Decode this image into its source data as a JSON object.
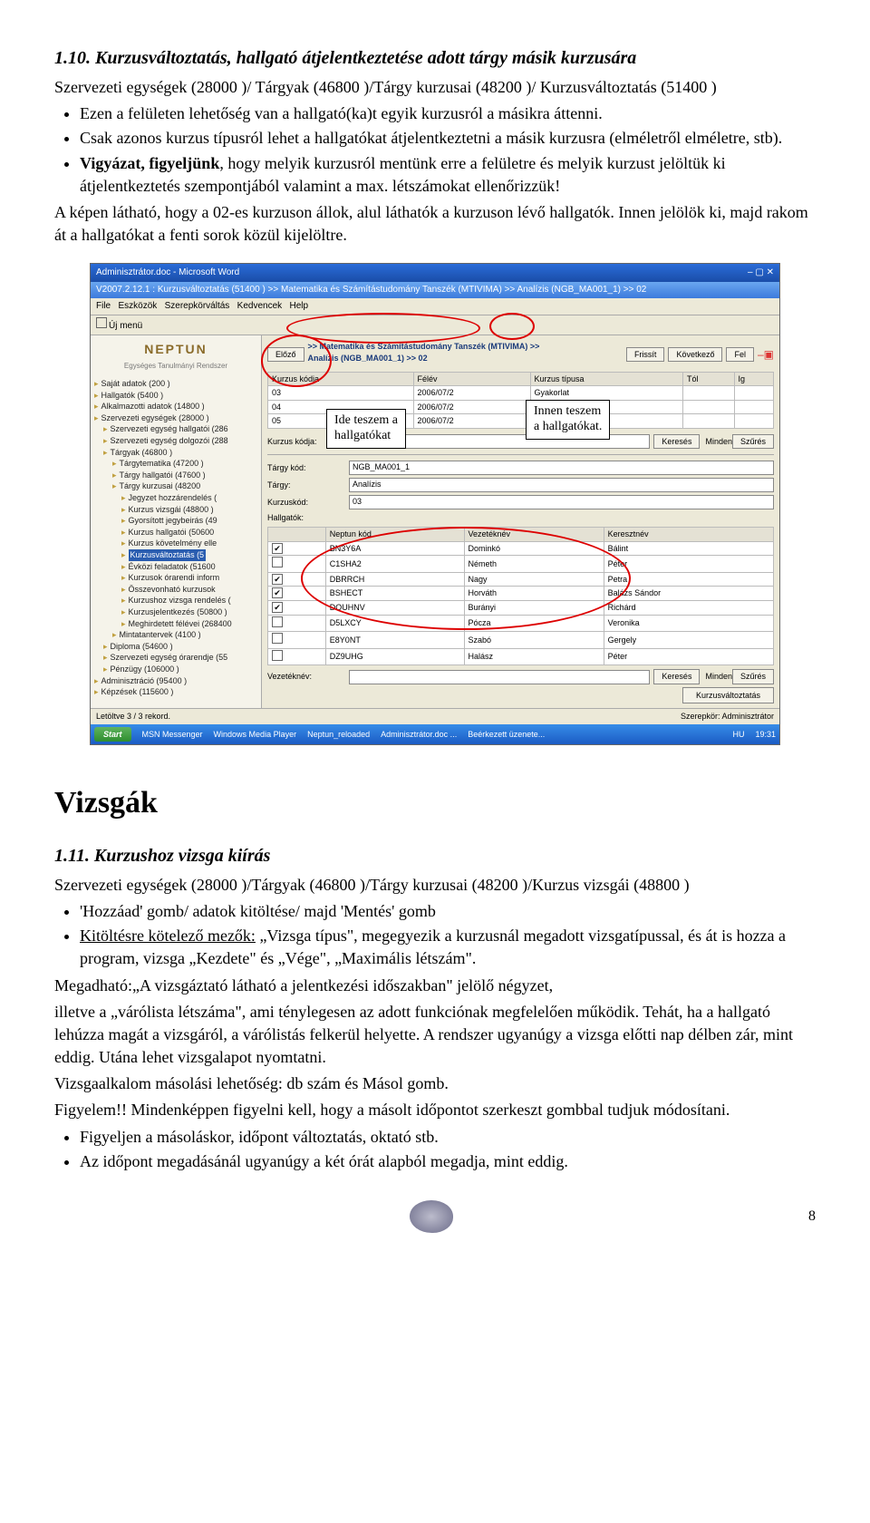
{
  "section1": {
    "heading": "1.10. Kurzusváltoztatás, hallgató átjelentkeztetése adott tárgy másik kurzusára",
    "path": "Szervezeti egységek (28000  )/ Tárgyak (46800  )/Tárgy kurzusai (48200  )/ Kurzusváltoztatás (51400  )",
    "b1": "Ezen a felületen lehetőség van a hallgató(ka)t egyik kurzusról a másikra áttenni.",
    "b2": "Csak azonos kurzus típusról lehet a hallgatókat átjelentkeztetni a másik kurzusra (elméletről elméletre, stb).",
    "b3a": "Vigyázat, figyeljünk",
    "b3b": ", hogy melyik kurzusról mentünk erre a felületre és melyik kurzust jelöltük ki átjelentkeztetés szempontjából valamint a max. létszámokat ellenőrizzük!",
    "p1": "A képen látható, hogy a 02-es kurzuson állok, alul láthatók a kurzuson lévő hallgatók. Innen jelölök ki, majd rakom át a hallgatókat a fenti sorok közül kijelöltre."
  },
  "screenshot": {
    "wordTitle": "Adminisztrátor.doc - Microsoft Word",
    "appTitle": "V2007.2.12.1 : Kurzusváltoztatás (51400  )  >> Matematika és Számítástudomány Tanszék (MTIVIMA) >> Analízis (NGB_MA001_1) >> 02",
    "menus": [
      "File",
      "Eszközök",
      "Szerepkörváltás",
      "Kedvencek",
      "Help"
    ],
    "ujmenu": "Új menü",
    "logo": "NEPTUN",
    "logoSub": "Egységes Tanulmányi Rendszer",
    "tree": [
      "Saját adatok (200  )",
      "Hallgatók (5400  )",
      "Alkalmazotti adatok (14800  )",
      "Szervezeti egységek (28000  )",
      "  Szervezeti egység hallgatói (286",
      "  Szervezeti egység dolgozói (288",
      "  Tárgyak (46800  )",
      "    Tárgytematika (47200  )",
      "    Tárgy hallgatói (47600  )",
      "    Tárgy kurzusai (48200",
      "      Jegyzet hozzárendelés (",
      "      Kurzus vizsgái (48800  )",
      "      Gyorsított jegybeirás (49",
      "      Kurzus hallgatói (50600",
      "      Kurzus követelmény elle",
      "      Kurzusváltoztatás (5",
      "      Évközi feladatok (51600",
      "      Kurzusok órarendi inform",
      "      Összevonható kurzusok",
      "      Kurzushoz vizsga rendelés (",
      "      Kurzusjelentkezés (50800  )",
      "      Meghirdetett félévei (268400",
      "    Mintatantervek (4100  )",
      "  Diploma (54600  )",
      "  Szervezeti egység órarendje (55",
      "  Pénzügy (106000  )",
      "Adminisztráció (95400  )",
      "Képzések (115600  )"
    ],
    "treeSelected": 15,
    "navBtns": [
      "Előző",
      "Frissít",
      "Következő",
      "Fel"
    ],
    "bc1": ">> Matematika és Számítástudomány Tanszék (MTIVIMA) >>",
    "bc2": "Analízis (NGB_MA001_1) >> 02",
    "topHeaders": [
      "Kurzus kódja",
      "Félév",
      "Kurzus típusa",
      "Tól",
      "Ig"
    ],
    "topRows": [
      [
        "03",
        "2006/07/2",
        "Gyakorlat",
        "",
        ""
      ],
      [
        "04",
        "2006/07/2",
        "Gyakorlat",
        "",
        ""
      ],
      [
        "05",
        "2006/07/2",
        "Gyakorlat",
        "",
        ""
      ]
    ],
    "filterLabel": "Kurzus kódja:",
    "keres": "Keresés",
    "minden": "Minden",
    "szures": "Szűrés",
    "formLabels": {
      "targyKod": "Tárgy kód:",
      "targyKodVal": "NGB_MA001_1",
      "targy": "Tárgy:",
      "targyVal": "Analízis",
      "kurzusKod": "Kurzuskód:",
      "kurzusKodVal": "03",
      "hallgatok": "Hallgatók:"
    },
    "stHeaders": [
      "",
      "Neptun kód",
      "Vezetéknév",
      "Keresztnév"
    ],
    "stRows": [
      [
        "✔",
        "BN3Y6A",
        "Dominkó",
        "Bálint"
      ],
      [
        "",
        "C1SHA2",
        "Németh",
        "Péter"
      ],
      [
        "✔",
        "DBRRCH",
        "Nagy",
        "Petra"
      ],
      [
        "✔",
        "BSHECT",
        "Horváth",
        "Balázs Sándor"
      ],
      [
        "✔",
        "DOUHNV",
        "Burányi",
        "Richárd"
      ],
      [
        "",
        "D5LXCY",
        "Pócza",
        "Veronika"
      ],
      [
        "",
        "E8Y0NT",
        "Szabó",
        "Gergely"
      ],
      [
        "",
        "DZ9UHG",
        "Halász",
        "Péter"
      ]
    ],
    "vezLabel": "Vezetéknév:",
    "bigBtn": "Kurzusváltoztatás",
    "status1": "Letöltve 3 / 3 rekord.",
    "status2": "Szerepkör: Adminisztrátor",
    "taskItems": [
      "Start",
      "MSN Messenger",
      "Windows Media Player",
      "Neptun_reloaded",
      "Adminisztrátor.doc ...",
      "Beérkezett üzenete..."
    ],
    "clock": "19:31",
    "lang": "HU",
    "callout1a": "Ide teszem a",
    "callout1b": "hallgatókat",
    "callout2a": "Innen teszem",
    "callout2b": "a hallgatókat."
  },
  "vizsgakHeading": "Vizsgák",
  "section2": {
    "heading": "1.11. Kurzushoz vizsga kiírás",
    "path": "Szervezeti egységek (28000  )/Tárgyak (46800  )/Tárgy kurzusai (48200  )/Kurzus vizsgái (48800  )",
    "b1": "'Hozzáad' gomb/ adatok kitöltése/ majd 'Mentés' gomb",
    "b2a": "Kitöltésre kötelező mezők:",
    "b2b": " „Vizsga típus\", megegyezik a kurzusnál megadott vizsgatípussal, és át is hozza a program, vizsga „Kezdete\" és „Vége\", „Maximális létszám\".",
    "p1": "Megadható:„A vizsgáztató látható a jelentkezési időszakban\" jelölő négyzet,",
    "p2": "illetve a „várólista létszáma\", ami ténylegesen az adott funkciónak megfelelően működik. Tehát, ha a hallgató lehúzza magát a vizsgáról, a várólistás felkerül helyette.  A rendszer ugyanúgy a vizsga előtti nap délben zár, mint eddig.  Utána lehet vizsgalapot nyomtatni.",
    "p3": "Vizsgaalkalom másolási lehetőség: db szám és Másol gomb.",
    "p4": "Figyelem!! Mindenképpen figyelni kell, hogy a másolt időpontot szerkeszt gombbal tudjuk módosítani.",
    "b3": "Figyeljen a másoláskor, időpont változtatás, oktató stb.",
    "b4": "Az időpont megadásánál ugyanúgy a két órát alapból megadja, mint eddig."
  },
  "pageNumber": "8"
}
